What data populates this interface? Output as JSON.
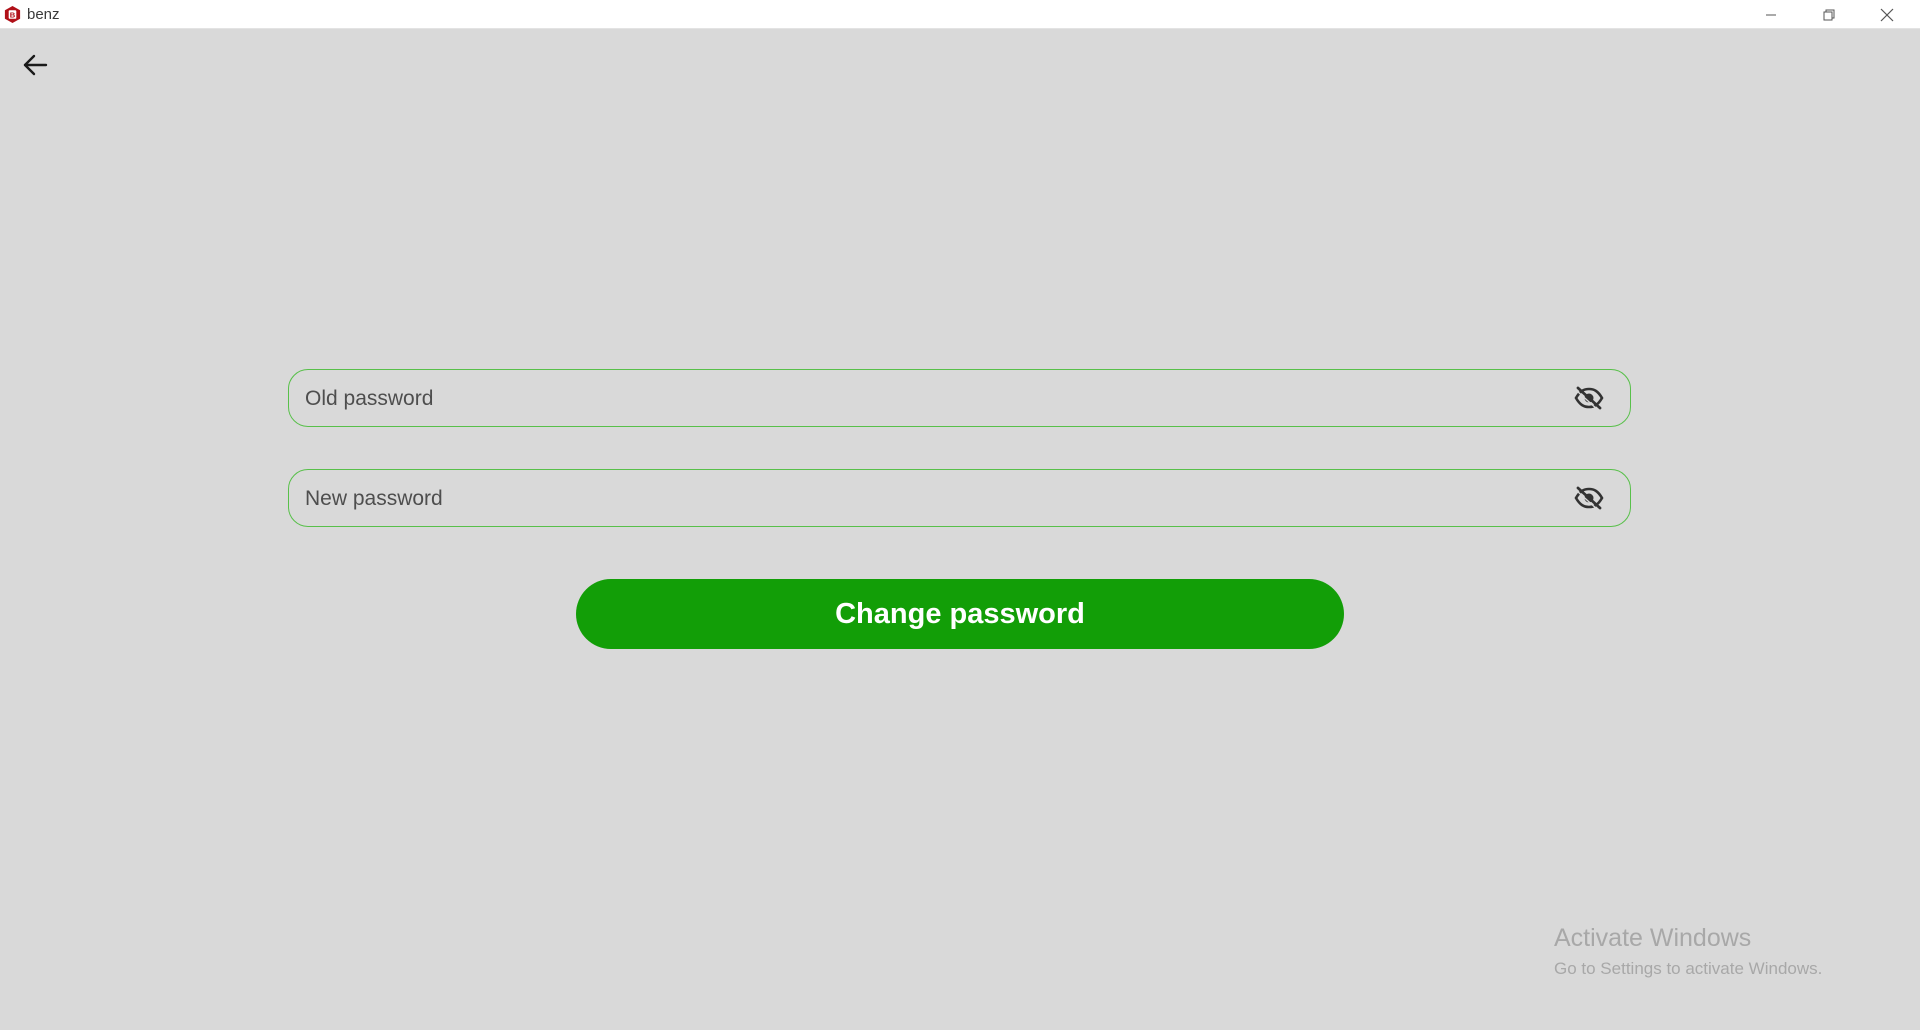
{
  "window": {
    "title": "benz",
    "logo_letter": "B",
    "minimize_icon": "minimize-icon",
    "restore_icon": "restore-icon",
    "close_icon": "close-icon"
  },
  "nav": {
    "back_icon": "arrow-left-icon"
  },
  "form": {
    "old_password": {
      "placeholder": "Old password",
      "value": "",
      "toggle_icon": "eye-off-icon"
    },
    "new_password": {
      "placeholder": "New password",
      "value": "",
      "toggle_icon": "eye-off-icon"
    },
    "submit_label": "Change password"
  },
  "watermark": {
    "title": "Activate Windows",
    "subtitle": "Go to Settings to activate Windows."
  },
  "colors": {
    "background": "#d9d9d9",
    "accent": "#129e07",
    "field_border": "#58c04a",
    "logo": "#b01018"
  }
}
